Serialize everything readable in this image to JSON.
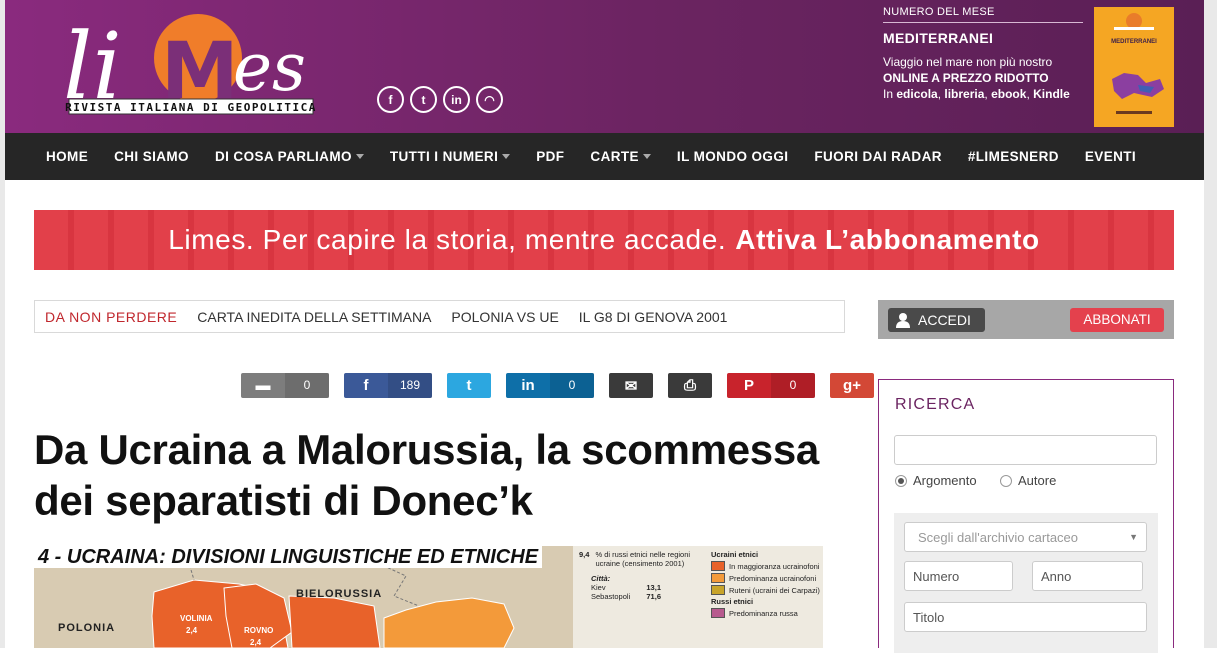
{
  "header": {
    "logo_text": "li",
    "logo_m": "M",
    "logo_es": "es",
    "logo_tagline": "RIVISTA ITALIANA DI GEOPOLITICA",
    "social": [
      {
        "icon": "facebook-icon",
        "glyph": "f"
      },
      {
        "icon": "twitter-icon",
        "glyph": "t"
      },
      {
        "icon": "linkedin-icon",
        "glyph": "in"
      },
      {
        "icon": "rss-icon",
        "glyph": "◠"
      }
    ],
    "issue": {
      "kicker": "NUMERO DEL MESE",
      "title": "MEDITERRANEI",
      "description": "Viaggio nel mare non più nostro",
      "offer": "ONLINE A PREZZO RIDOTTO",
      "formats_prefix": "In",
      "formats": [
        "edicola",
        "libreria",
        "ebook",
        "Kindle"
      ],
      "cover_title": "MEDITERRANEI"
    }
  },
  "nav": [
    {
      "label": "HOME",
      "dropdown": false
    },
    {
      "label": "CHI SIAMO",
      "dropdown": false
    },
    {
      "label": "DI COSA PARLIAMO",
      "dropdown": true
    },
    {
      "label": "TUTTI I NUMERI",
      "dropdown": true
    },
    {
      "label": "PDF",
      "dropdown": false
    },
    {
      "label": "CARTE",
      "dropdown": true
    },
    {
      "label": "IL MONDO OGGI",
      "dropdown": false
    },
    {
      "label": "FUORI DAI RADAR",
      "dropdown": false
    },
    {
      "label": "#LIMESNERD",
      "dropdown": false
    },
    {
      "label": "EVENTI",
      "dropdown": false
    }
  ],
  "banner": {
    "text": "Limes. Per capire la storia, mentre accade.",
    "cta": "Attiva L’abbonamento"
  },
  "dnp": {
    "label": "DA NON PERDERE",
    "links": [
      "CARTA INEDITA DELLA SETTIMANA",
      "POLONIA VS UE",
      "IL G8 DI GENOVA 2001"
    ]
  },
  "share": [
    {
      "icon": "comment-icon",
      "glyph": "▬",
      "count": "0",
      "color": "#7d7d7d"
    },
    {
      "icon": "facebook-share-icon",
      "glyph": "f",
      "count": "189",
      "color": "#3b5998"
    },
    {
      "icon": "twitter-share-icon",
      "glyph": "t",
      "count": "",
      "color": "#2ca7e0"
    },
    {
      "icon": "linkedin-share-icon",
      "glyph": "in",
      "count": "0",
      "color": "#0e6fa8"
    },
    {
      "icon": "email-icon",
      "glyph": "✉",
      "count": "",
      "color": "#3a3a3a"
    },
    {
      "icon": "print-icon",
      "glyph": "⎙",
      "count": "",
      "color": "#3a3a3a"
    },
    {
      "icon": "pinterest-icon",
      "glyph": "P",
      "count": "0",
      "color": "#c8232c"
    },
    {
      "icon": "googleplus-icon",
      "glyph": "g+",
      "count": "",
      "color": "#d34836"
    }
  ],
  "article": {
    "headline": "Da Ucraina a Malorussia, la scommessa dei separatisti di Donec’k",
    "map": {
      "title": "4 - UCRAINA: DIVISIONI LINGUISTICHE ED ETNICHE",
      "labels": [
        "BIELORUSSIA",
        "POLONIA"
      ],
      "small_labels": [
        "VOLINIA",
        "2,4",
        "ROVNO",
        "2,4"
      ],
      "legend_pct": "9,4",
      "legend_pct_text": "% di russi etnici nelle regioni ucraine (censimento 2001)",
      "legend_city_head": "Città:",
      "legend_cities": [
        {
          "name": "Kiev",
          "value": "13,1"
        },
        {
          "name": "Sebastopoli",
          "value": "71,6"
        }
      ],
      "legend_head_ua": "Ucraini etnici",
      "legend_ua": [
        {
          "label": "In maggioranza ucrainofoni",
          "color": "#e8622a"
        },
        {
          "label": "Predominanza ucrainofoni",
          "color": "#f39a3a"
        },
        {
          "label": "Ruteni (ucraini dei Carpazi)",
          "color": "#c8a42a"
        }
      ],
      "legend_head_ru": "Russi etnici",
      "legend_ru": [
        {
          "label": "Predominanza russa",
          "color": "#b75a8e"
        }
      ]
    }
  },
  "sidebar": {
    "login_label": "ACCEDI",
    "subscribe_label": "ABBONATI",
    "search": {
      "title": "RICERCA",
      "search_value": "",
      "radio_topic": "Argomento",
      "radio_author": "Autore",
      "archive_placeholder": "Scegli dall'archivio cartaceo",
      "number_placeholder": "Numero",
      "year_placeholder": "Anno",
      "title_placeholder": "Titolo"
    }
  }
}
